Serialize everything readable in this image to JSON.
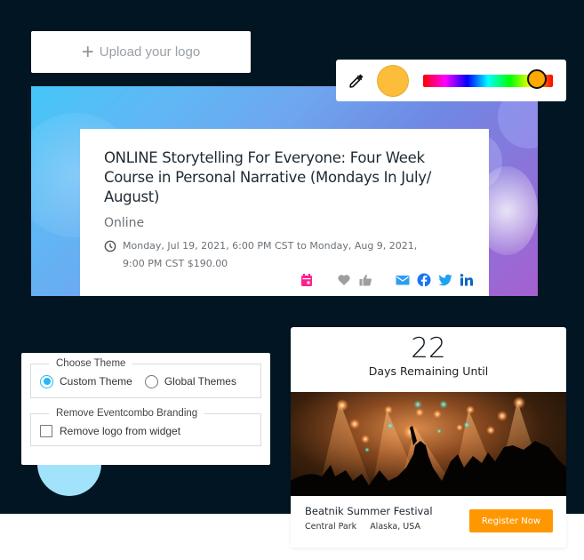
{
  "upload": {
    "icon": "plus-icon",
    "label": "Upload your logo"
  },
  "color_picker": {
    "eyedropper_icon": "eyedropper-icon",
    "selected_color": "#fbbd3a",
    "hue_position_percent": 88
  },
  "event": {
    "title": "ONLINE Storytelling For Everyone: Four Week Course in Personal Narrative (Mondays In July/ August)",
    "location": "Online",
    "datetime": "Monday, Jul 19, 2021, 6:00 PM CST to Monday, Aug 9, 2021, 9:00 PM CST $190.00",
    "actions": [
      {
        "icon": "calendar-icon",
        "color": "#ff1f8e"
      },
      {
        "icon": "heart-icon",
        "color": "#9e9e9e"
      },
      {
        "icon": "thumbs-up-icon",
        "color": "#9e9e9e"
      },
      {
        "icon": "email-icon",
        "color": "#2a9ff0"
      },
      {
        "icon": "facebook-icon",
        "color": "#1877f2"
      },
      {
        "icon": "twitter-icon",
        "color": "#1da1f2"
      },
      {
        "icon": "linkedin-icon",
        "color": "#0a66c2"
      }
    ]
  },
  "theme": {
    "choose_legend": "Choose Theme",
    "options": [
      {
        "label": "Custom Theme",
        "selected": true
      },
      {
        "label": "Global Themes",
        "selected": false
      }
    ],
    "branding_legend": "Remove Eventcombo Branding",
    "branding_checkbox": {
      "label": "Remove logo from widget",
      "checked": false
    }
  },
  "countdown": {
    "days": "22",
    "label": "Days Remaining Until",
    "event_name": "Beatnik Summer Festival",
    "venue": "Central Park",
    "region": "Alaska, USA",
    "register_label": "Register Now",
    "accent": "#ff9800"
  }
}
